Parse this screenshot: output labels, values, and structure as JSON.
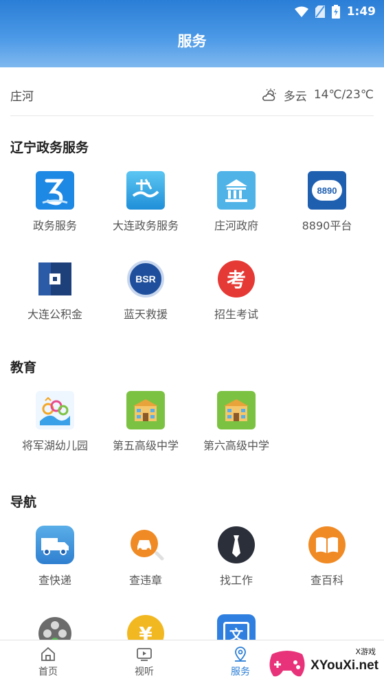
{
  "status_bar": {
    "time": "1:49"
  },
  "header": {
    "title": "服务"
  },
  "weather": {
    "location": "庄河",
    "condition": "多云",
    "temperature": "14℃/23℃"
  },
  "sections": [
    {
      "title": "辽宁政务服务",
      "items": [
        {
          "label": "政务服务",
          "icon": "liaoning-gov-icon",
          "color": "#1e88e5"
        },
        {
          "label": "大连政务服务",
          "icon": "dalian-gov-icon",
          "color": "#29a6e8"
        },
        {
          "label": "庄河政府",
          "icon": "government-building-icon",
          "color": "#4fb3e8"
        },
        {
          "label": "8890平台",
          "icon": "8890-platform-icon",
          "color": "#1f5fb0",
          "icon_text": "8890"
        },
        {
          "label": "大连公积金",
          "icon": "housing-fund-icon",
          "color": "#1d3f7a"
        },
        {
          "label": "蓝天救援",
          "icon": "blue-sky-rescue-icon",
          "color": "#1f4f9c",
          "icon_text": "BSR"
        },
        {
          "label": "招生考试",
          "icon": "exam-icon",
          "color": "#e53935",
          "icon_text": "考"
        }
      ]
    },
    {
      "title": "教育",
      "items": [
        {
          "label": "将军湖幼儿园",
          "icon": "kindergarten-icon",
          "color": "#f4a623"
        },
        {
          "label": "第五高级中学",
          "icon": "school-building-icon",
          "color": "#7cc242"
        },
        {
          "label": "第六高级中学",
          "icon": "school-building-icon",
          "color": "#7cc242"
        }
      ]
    },
    {
      "title": "导航",
      "items": [
        {
          "label": "查快递",
          "icon": "delivery-truck-icon",
          "color": "#3a8fd9"
        },
        {
          "label": "查违章",
          "icon": "car-violation-icon",
          "color": "#f08a24"
        },
        {
          "label": "找工作",
          "icon": "necktie-icon",
          "color": "#2b2f3a"
        },
        {
          "label": "查百科",
          "icon": "book-icon",
          "color": "#f08a24"
        },
        {
          "label": "",
          "icon": "film-reel-icon",
          "color": "#6c6c6c"
        },
        {
          "label": "",
          "icon": "yen-coin-icon",
          "color": "#f2b822",
          "icon_text": "¥"
        },
        {
          "label": "",
          "icon": "translate-icon",
          "color": "#2f7fe0",
          "icon_text": "文"
        }
      ]
    }
  ],
  "bottom_nav": [
    {
      "label": "首页",
      "icon": "home-icon",
      "active": false
    },
    {
      "label": "视听",
      "icon": "tv-icon",
      "active": false
    },
    {
      "label": "服务",
      "icon": "location-pin-icon",
      "active": true
    }
  ],
  "watermark": {
    "brand": "XYouXi.net",
    "tag": "X游戏"
  }
}
